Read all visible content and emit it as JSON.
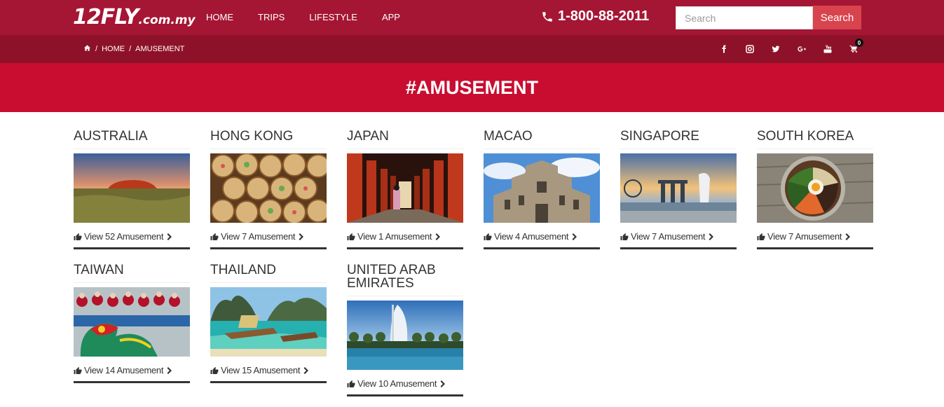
{
  "header": {
    "logo_main": "12FLY",
    "logo_domain": ".com.my",
    "nav": [
      "HOME",
      "TRIPS",
      "LIFESTYLE",
      "APP"
    ],
    "phone": "1-800-88-2011",
    "search_placeholder": "Search",
    "search_button": "Search"
  },
  "breadcrumb": {
    "home": "HOME",
    "current": "AMUSEMENT",
    "sep": "/"
  },
  "social_icons": [
    "facebook-icon",
    "instagram-icon",
    "twitter-icon",
    "google-plus-icon",
    "youtube-icon",
    "cart-icon"
  ],
  "cart_count": "0",
  "banner_title": "#AMUSEMENT",
  "destinations": [
    {
      "name": "AUSTRALIA",
      "link": "View 52 Amusement"
    },
    {
      "name": "HONG KONG",
      "link": "View 7 Amusement"
    },
    {
      "name": "JAPAN",
      "link": "View 1 Amusement"
    },
    {
      "name": "MACAO",
      "link": "View 4 Amusement"
    },
    {
      "name": "SINGAPORE",
      "link": "View 7 Amusement"
    },
    {
      "name": "SOUTH KOREA",
      "link": "View 7 Amusement"
    },
    {
      "name": "TAIWAN",
      "link": "View 14 Amusement"
    },
    {
      "name": "THAILAND",
      "link": "View 15 Amusement"
    },
    {
      "name": "UNITED ARAB EMIRATES",
      "link": "View 10 Amusement"
    }
  ],
  "colors": {
    "topbar": "#a51634",
    "subbar": "#8d1229",
    "banner": "#c90d30",
    "search_button": "#d8444d"
  }
}
